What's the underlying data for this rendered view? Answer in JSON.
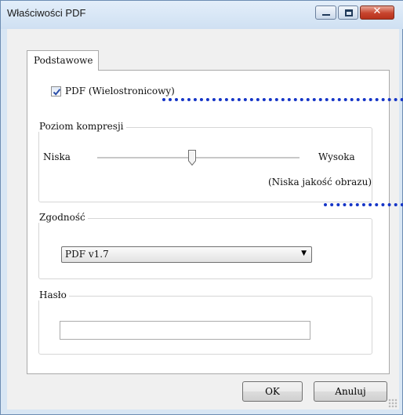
{
  "window": {
    "title": "Właściwości PDF",
    "close_glyph": "✕"
  },
  "tabs": [
    {
      "label": "Podstawowe",
      "active": true
    }
  ],
  "pdf_multipage": {
    "label": "PDF (Wielostronicowy)",
    "checked": true
  },
  "compression": {
    "legend": "Poziom kompresji",
    "low_label": "Niska",
    "high_label": "Wysoka",
    "note": "(Niska jakość obrazu)",
    "level_fraction": 0.47
  },
  "compatibility": {
    "legend": "Zgodność",
    "selected": "PDF v1.7"
  },
  "password": {
    "legend": "Hasło",
    "value": ""
  },
  "buttons": {
    "ok": "OK",
    "cancel": "Anuluj"
  },
  "colors": {
    "accent_dots": "#1535c7",
    "checkmark": "#2b4fa8"
  },
  "icons": {
    "minimize": "minimize-icon",
    "maximize": "maximize-icon",
    "close": "close-icon",
    "checkbox": "checkmark-icon",
    "dropdown": "chevron-down-icon"
  }
}
